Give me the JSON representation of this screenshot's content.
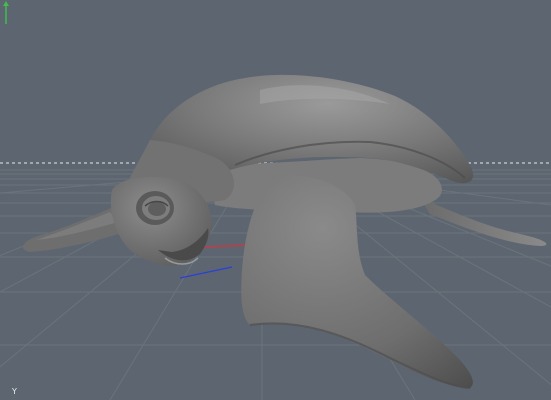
{
  "viewport": {
    "background_color": "#5d6670",
    "grid_color": "#6b737c",
    "horizon_line_color": "#e8e8e8",
    "x_axis_color": "#d8323a",
    "z_axis_color": "#2b3fd9",
    "model_color": "#6f6f6f",
    "model_name": "sea-turtle"
  },
  "axis_indicator": {
    "label": "Y",
    "icon": "y-axis-arrow-icon"
  }
}
